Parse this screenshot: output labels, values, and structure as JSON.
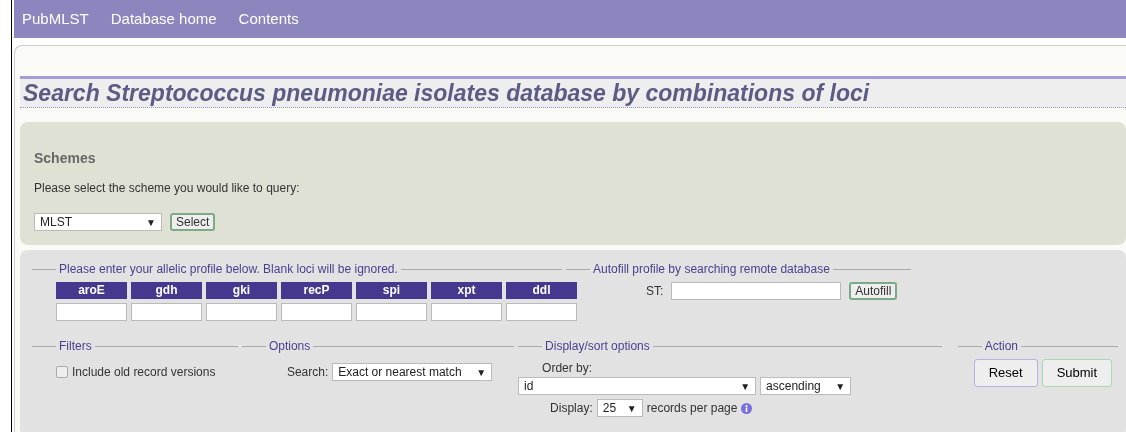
{
  "nav": [
    {
      "label": "PubMLST"
    },
    {
      "label": "Database home"
    },
    {
      "label": "Contents"
    }
  ],
  "title": "Search Streptococcus pneumoniae isolates database by combinations of loci",
  "schemes": {
    "heading": "Schemes",
    "prompt": "Please select the scheme you would like to query:",
    "scheme_select": {
      "value": "MLST",
      "arrow": "▼"
    },
    "select_button": "Select"
  },
  "profile": {
    "legend": "Please enter your allelic profile below. Blank loci will be ignored.",
    "loci": [
      "aroE",
      "gdh",
      "gki",
      "recP",
      "spi",
      "xpt",
      "ddl"
    ]
  },
  "autofill": {
    "legend": "Autofill profile by searching remote database",
    "st_label": "ST:",
    "button": "Autofill"
  },
  "filters": {
    "legend": "Filters",
    "include_old": {
      "label": "Include old record versions",
      "checked": false
    }
  },
  "options": {
    "legend": "Options",
    "search_label": "Search:",
    "search_select": {
      "value": "Exact or nearest match",
      "arrow": "▼"
    }
  },
  "display_sort": {
    "legend": "Display/sort options",
    "order_label": "Order by:",
    "order_select": {
      "value": "id",
      "arrow": "▼"
    },
    "direction_select": {
      "value": "ascending",
      "arrow": "▼"
    },
    "display_label": "Display:",
    "display_select": {
      "value": "25",
      "arrow": "▼"
    },
    "suffix": "records per page"
  },
  "action": {
    "legend": "Action",
    "buttons": [
      {
        "label": "Reset",
        "kind": "reset"
      },
      {
        "label": "Submit",
        "kind": "submit"
      }
    ]
  }
}
